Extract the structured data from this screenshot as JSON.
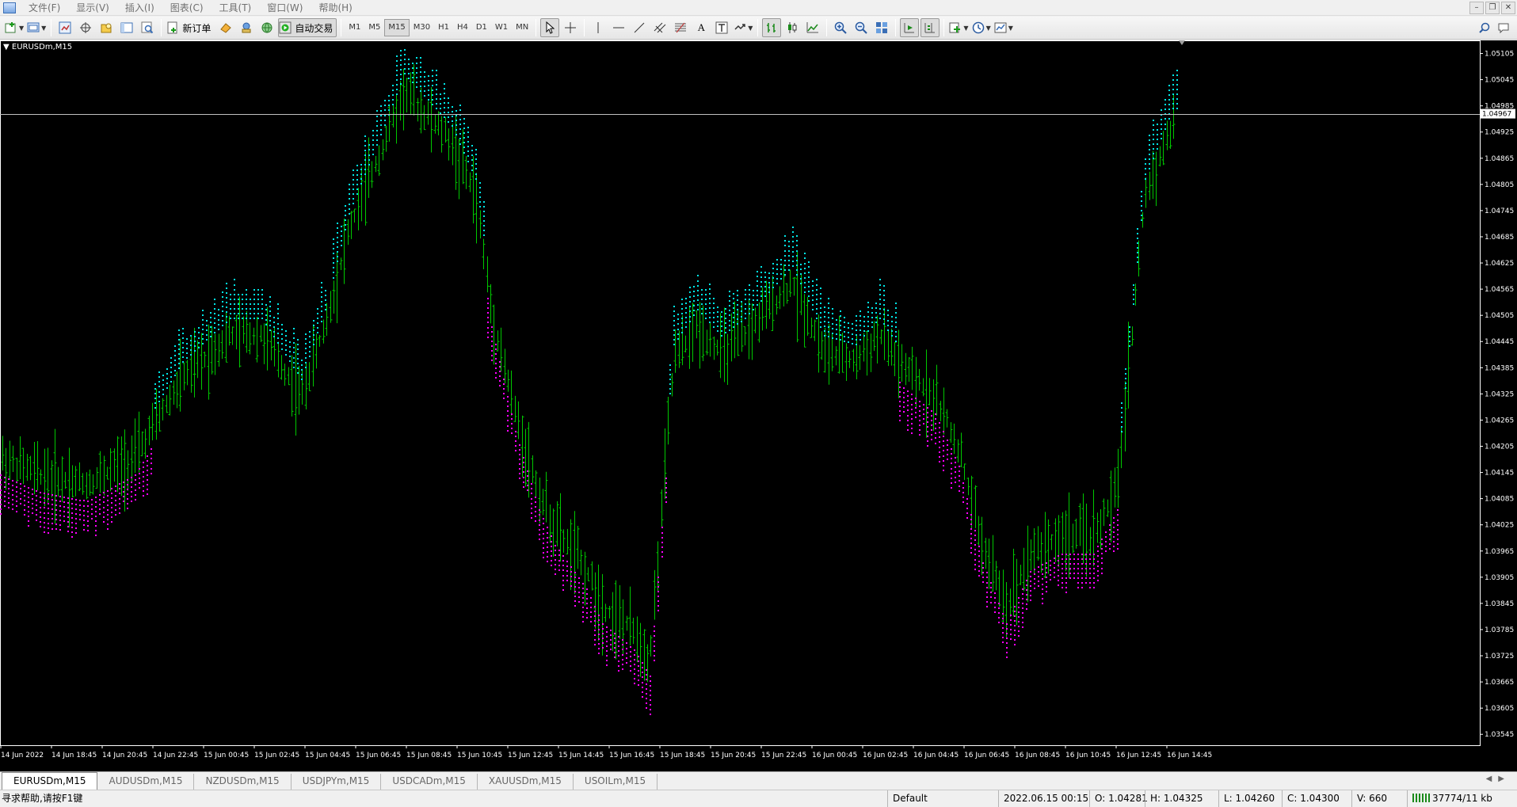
{
  "menu": {
    "items": [
      "文件(F)",
      "显示(V)",
      "插入(I)",
      "图表(C)",
      "工具(T)",
      "窗口(W)",
      "帮助(H)"
    ]
  },
  "toolbar": {
    "new_order_label": "新订单",
    "auto_trading_label": "自动交易",
    "timeframes": [
      "M1",
      "M5",
      "M15",
      "M30",
      "H1",
      "H4",
      "D1",
      "W1",
      "MN"
    ],
    "active_timeframe": "M15"
  },
  "chart": {
    "title": "EURUSDm,M15",
    "current_price_label": "1.04967",
    "price_scale": [
      "1.05105",
      "1.05045",
      "1.04985",
      "1.04925",
      "1.04865",
      "1.04805",
      "1.04745",
      "1.04685",
      "1.04625",
      "1.04565",
      "1.04505",
      "1.04445",
      "1.04385",
      "1.04325",
      "1.04265",
      "1.04205",
      "1.04145",
      "1.04085",
      "1.04025",
      "1.03965",
      "1.03905",
      "1.03845",
      "1.03785",
      "1.03725",
      "1.03665",
      "1.03605",
      "1.03545"
    ],
    "time_scale": [
      "14 Jun 2022",
      "14 Jun 18:45",
      "14 Jun 20:45",
      "14 Jun 22:45",
      "15 Jun 00:45",
      "15 Jun 02:45",
      "15 Jun 04:45",
      "15 Jun 06:45",
      "15 Jun 08:45",
      "15 Jun 10:45",
      "15 Jun 12:45",
      "15 Jun 14:45",
      "15 Jun 16:45",
      "15 Jun 18:45",
      "15 Jun 20:45",
      "15 Jun 22:45",
      "16 Jun 00:45",
      "16 Jun 02:45",
      "16 Jun 04:45",
      "16 Jun 06:45",
      "16 Jun 08:45",
      "16 Jun 10:45",
      "16 Jun 12:45",
      "16 Jun 14:45"
    ],
    "colors": {
      "background": "#000000",
      "bars": "#00c800",
      "up_dots": "#00e6e6",
      "down_dots": "#ff00ff",
      "axis": "#ffffff"
    }
  },
  "tabs": {
    "items": [
      "EURUSDm,M15",
      "AUDUSDm,M15",
      "NZDUSDm,M15",
      "USDJPYm,M15",
      "USDCADm,M15",
      "XAUUSDm,M15",
      "USOILm,M15"
    ],
    "active": "EURUSDm,M15"
  },
  "status": {
    "help": "寻求帮助,请按F1键",
    "profile": "Default",
    "datetime": "2022.06.15 00:15",
    "open": "O: 1.04281",
    "high": "H: 1.04325",
    "low": "L: 1.04260",
    "close": "C: 1.04300",
    "volume": "V: 660",
    "traffic": "37774/11 kb"
  }
}
